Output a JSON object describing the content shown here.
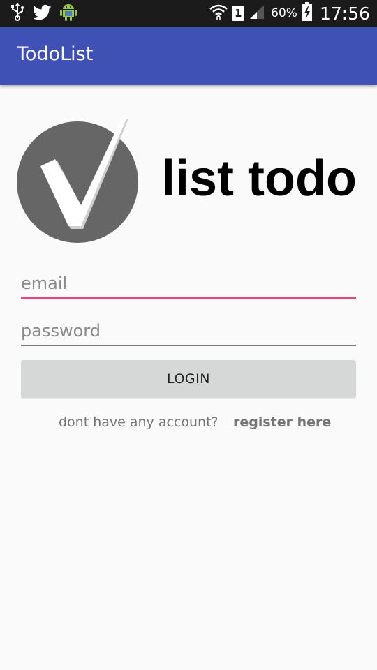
{
  "status_bar": {
    "icons_left": [
      "usb-icon",
      "twitter-icon",
      "android-icon"
    ],
    "icons_right": [
      "wifi-icon",
      "signal-icon",
      "battery-charging-icon"
    ],
    "sim_slot": "1",
    "battery_percent": "60%",
    "time": "17:56"
  },
  "app_bar": {
    "title": "TodoList",
    "color": "#3f51b5"
  },
  "logo": {
    "icon": "checkmark-circle-icon",
    "text": "list todo"
  },
  "form": {
    "email_placeholder": "email",
    "email_value": "",
    "password_placeholder": "password",
    "password_value": "",
    "login_label": "LOGIN",
    "accent_color": "#e8457d"
  },
  "register": {
    "prompt": "dont have any account?",
    "link_label": "register here"
  }
}
